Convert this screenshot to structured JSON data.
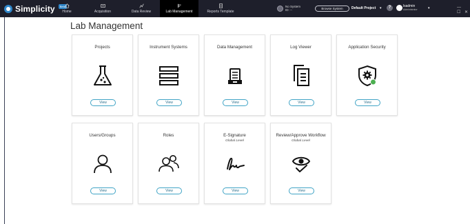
{
  "app": {
    "brand": "Simplicity",
    "badge": "Beta",
    "window_controls": "— ☐ ✕"
  },
  "nav": {
    "home": "Home",
    "acquisition": "Acquisition",
    "data_review": "Data Review",
    "lab_management": "Lab Management",
    "reports_template": "Reports Template",
    "active": "Lab Management"
  },
  "header": {
    "system_line1": "No System",
    "system_line2": "ID: --",
    "browse_label": "Browse System",
    "project": "Default Project",
    "help_label": "?",
    "user_name": "lsadmin",
    "user_role": "Administrator"
  },
  "page": {
    "title": "Lab Management"
  },
  "cards": [
    {
      "title": "Projects",
      "subtitle": "",
      "icon": "flask-icon",
      "button": "View"
    },
    {
      "title": "Instrument Systems",
      "subtitle": "",
      "icon": "stack-icon",
      "button": "View"
    },
    {
      "title": "Data Management",
      "subtitle": "",
      "icon": "archive-icon",
      "button": "View"
    },
    {
      "title": "Log Viewer",
      "subtitle": "",
      "icon": "documents-icon",
      "button": "View"
    },
    {
      "title": "Application Security",
      "subtitle": "",
      "icon": "shield-gear-icon",
      "button": "View"
    },
    {
      "title": "Users/Groups",
      "subtitle": "",
      "icon": "user-icon",
      "button": "View"
    },
    {
      "title": "Roles",
      "subtitle": "",
      "icon": "users-icon",
      "button": "View"
    },
    {
      "title": "E-Signature",
      "subtitle": "Global Level",
      "icon": "signature-icon",
      "button": "View"
    },
    {
      "title": "Review/Approve Workflow",
      "subtitle": "Global Level",
      "icon": "eye-check-icon",
      "button": "View"
    }
  ],
  "colors": {
    "topbar": "#1e1f2b",
    "active_tab": "#000000",
    "button_border": "#3fa3c5",
    "shield_status": "#4caf50"
  }
}
